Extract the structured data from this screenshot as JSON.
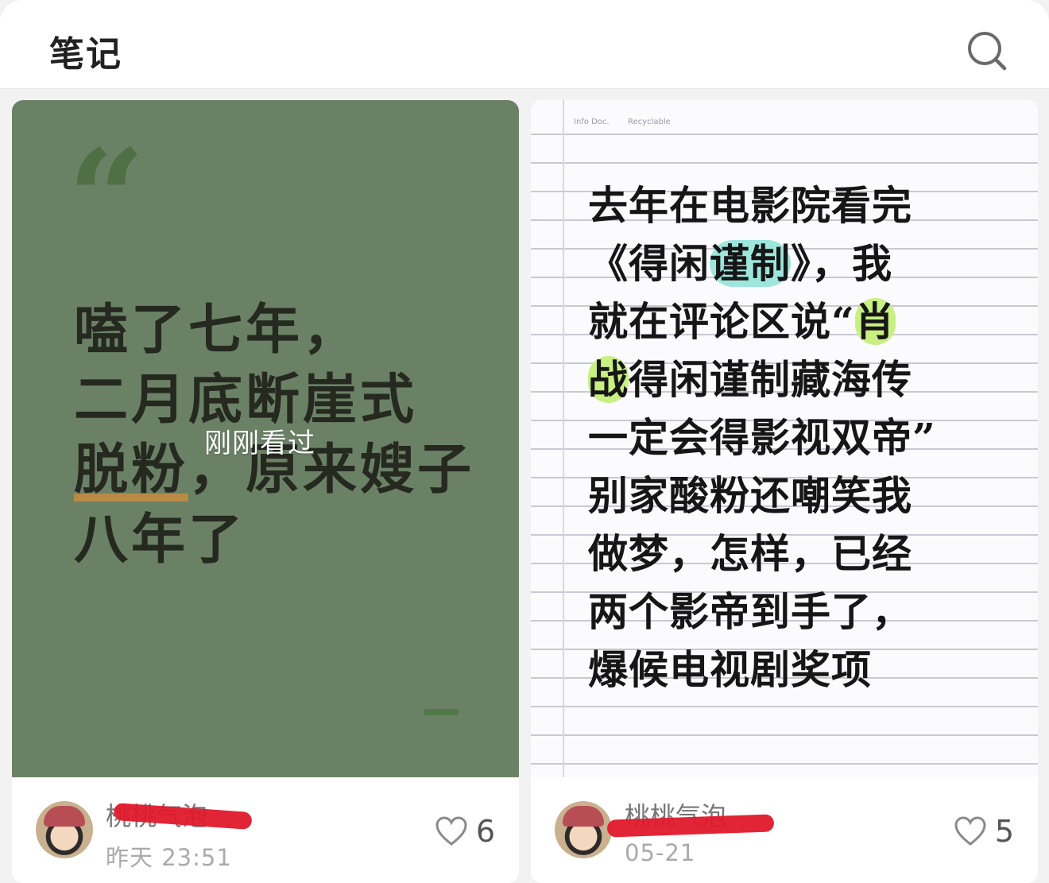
{
  "header": {
    "title": "笔记"
  },
  "notes": [
    {
      "cover_lines": [
        "嗑了七年，",
        "二月底断崖式"
      ],
      "cover_line3_highlight": "脱粉",
      "cover_line3_rest": "，原来嫂子",
      "cover_line4": "八年了",
      "overlay": "刚刚看过",
      "author": "桃桃气泡",
      "time": "昨天 23:51",
      "likes": "6"
    },
    {
      "paper_head": [
        "Info Doc.",
        "Recyclable"
      ],
      "line1": "去年在电影院看完",
      "line2_a": "《得闲",
      "line2_hl": "谨制",
      "line2_b": "》，我",
      "line3_a": "就在评论区说“",
      "line3_hl": "肖",
      "line4_hl": "战",
      "line4_b": "得闲谨制藏海传",
      "rest_lines": [
        "一定会得影视双帝”",
        "别家酸粉还嘲笑我",
        "做梦，怎样，已经",
        "两个影帝到手了，",
        "爆候电视剧奖项"
      ],
      "author": "桃桃气泡",
      "time": "05-21",
      "likes": "5"
    }
  ]
}
